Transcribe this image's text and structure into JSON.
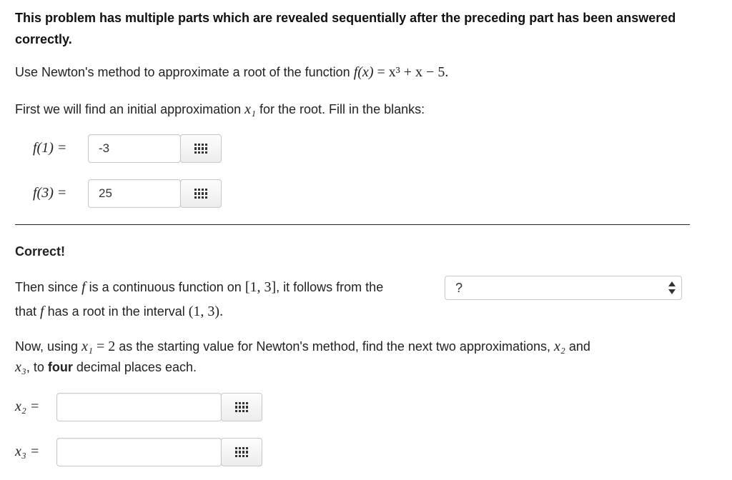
{
  "intro": {
    "header": "This problem has multiple parts which are revealed sequentially after the preceding part has been answered correctly.",
    "instruction_text": "Use Newton's method to approximate a root of the function",
    "function_lhs": "f(x)",
    "function_rhs": "= x³ + x − 5.",
    "first_text_a": "First we will find an initial approximation",
    "first_var": "x₁",
    "first_text_b": "for the root. Fill in the blanks:"
  },
  "part1": {
    "f1_label": "f(1) =",
    "f1_value": "-3",
    "f3_label": "f(3) =",
    "f3_value": "25",
    "feedback": "Correct!"
  },
  "part2": {
    "text_a": "Then since",
    "f": "f",
    "text_b": "is a continuous function on",
    "interval_closed": "[1, 3]",
    "text_c": ", it follows from the",
    "select_value": "?",
    "text_d": "that",
    "text_e": "has a root in the interval",
    "interval_open": "(1, 3)."
  },
  "part3": {
    "text_a": "Now, using",
    "x1": "x₁",
    "eq_start": "= 2",
    "text_b": "as the starting value for Newton's method, find the next two approximations,",
    "x2": "x₂",
    "text_and": "and",
    "x3": "x₃",
    "text_c": ", to",
    "bold_word": "four",
    "text_d": "decimal places each.",
    "x2_label": "x₂ =",
    "x2_value": "",
    "x3_label": "x₃ =",
    "x3_value": ""
  },
  "icons": {
    "grid": "grid-keypad-icon",
    "select": "updown-arrows-icon"
  }
}
